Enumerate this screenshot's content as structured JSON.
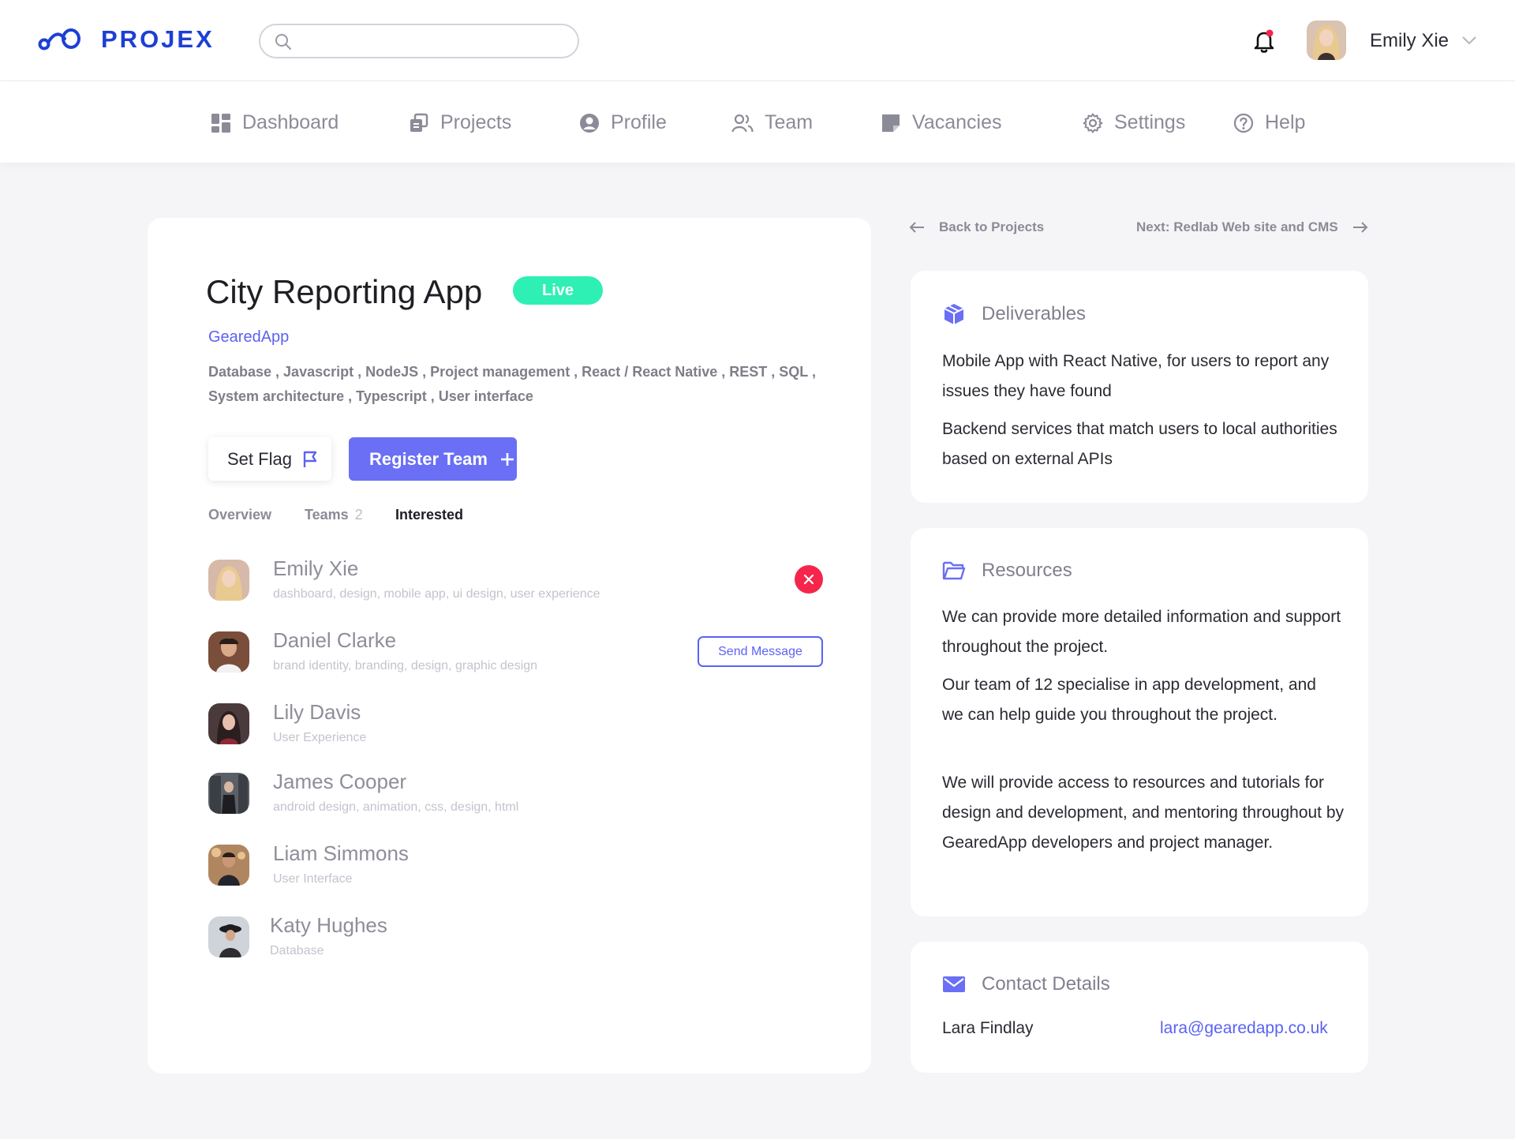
{
  "app": {
    "name": "PROJEX",
    "search_placeholder": "",
    "user_name": "Emily Xie"
  },
  "nav": [
    {
      "label": "Dashboard",
      "icon": "dashboard-icon"
    },
    {
      "label": "Projects",
      "icon": "projects-icon"
    },
    {
      "label": "Profile",
      "icon": "profile-icon"
    },
    {
      "label": "Team",
      "icon": "team-icon"
    },
    {
      "label": "Vacancies",
      "icon": "vacancies-icon"
    },
    {
      "label": "Settings",
      "icon": "gear-icon"
    },
    {
      "label": "Help",
      "icon": "help-icon"
    }
  ],
  "project": {
    "title": "City Reporting App",
    "status": "Live",
    "company": "GearedApp",
    "skills": "Database , Javascript , NodeJS , Project management , React / React Native , REST , SQL , System architecture , Typescript , User interface",
    "set_flag_label": "Set Flag",
    "register_label": "Register Team",
    "tabs": [
      {
        "label": "Overview",
        "count": ""
      },
      {
        "label": "Teams",
        "count": "2"
      },
      {
        "label": "Interested",
        "count": ""
      }
    ],
    "active_tab": "Interested",
    "send_message_label": "Send Message",
    "members": [
      {
        "name": "Emily Xie",
        "tags": "dashboard, design, mobile app, ui design, user experience"
      },
      {
        "name": "Daniel Clarke",
        "tags": "brand identity, branding, design, graphic design"
      },
      {
        "name": "Lily Davis",
        "tags": "User Experience"
      },
      {
        "name": "James Cooper",
        "tags": "android design, animation, css, design, html"
      },
      {
        "name": "Liam Simmons",
        "tags": "User Interface"
      },
      {
        "name": "Katy Hughes",
        "tags": "Database"
      }
    ]
  },
  "links": {
    "back": "Back to Projects",
    "next": "Next: Redlab Web site and CMS"
  },
  "deliverables": {
    "title": "Deliverables",
    "items": [
      "Mobile App with React Native, for users to report any issues they have found",
      "Backend services that match users to local authorities based on external APIs"
    ]
  },
  "resources": {
    "title": "Resources",
    "items": [
      "We can provide more detailed information and support throughout the project.",
      "Our team of 12 specialise in app development, and we can help guide you throughout the project.",
      "We will provide access to resources and tutorials for design and development, and mentoring throughout by GearedApp developers and project manager."
    ]
  },
  "contact": {
    "title": "Contact Details",
    "name": "Lara Findlay",
    "email": "lara@gearedapp.co.uk"
  },
  "colors": {
    "brand": "#1d3fd6",
    "accent": "#6a6ff5",
    "live": "#2ef0b4",
    "danger": "#f5254c"
  }
}
